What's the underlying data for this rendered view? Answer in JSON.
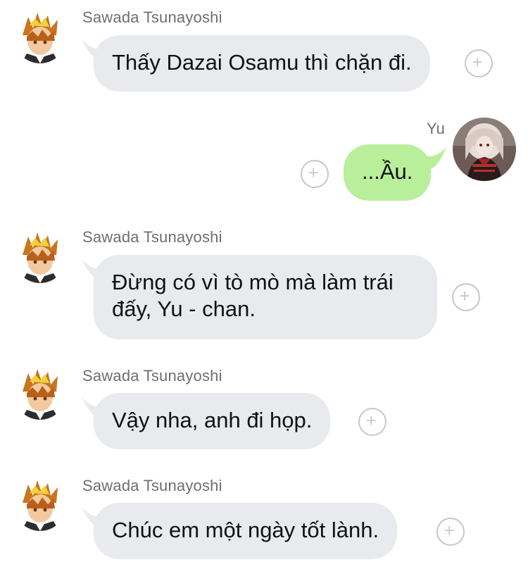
{
  "messages": [
    {
      "id": "m1",
      "direction": "incoming",
      "sender": "Sawada Tsunayoshi",
      "text": "Thấy Dazai Osamu thì chặn đi."
    },
    {
      "id": "m2",
      "direction": "outgoing",
      "sender": "Yu",
      "text": "...Ầu."
    },
    {
      "id": "m3",
      "direction": "incoming",
      "sender": "Sawada Tsunayoshi",
      "lines": [
        "Đừng có vì tò mò mà làm trái",
        "đấy, Yu - chan."
      ]
    },
    {
      "id": "m4",
      "direction": "incoming",
      "sender": "Sawada Tsunayoshi",
      "text": "Vậy nha, anh đi họp."
    },
    {
      "id": "m5",
      "direction": "incoming",
      "sender": "Sawada Tsunayoshi",
      "text": "Chúc em một ngày tốt lành."
    }
  ],
  "icons": {
    "reaction": "plus-circle-icon",
    "tsuna_avatar": "tsuna-avatar-icon",
    "yu_avatar": "yu-avatar-icon"
  },
  "colors": {
    "incoming_bubble": "#e8eaee",
    "outgoing_bubble": "#b9ee9a",
    "sender_name": "#6e6e73",
    "plus_border": "#c7c7cc"
  }
}
